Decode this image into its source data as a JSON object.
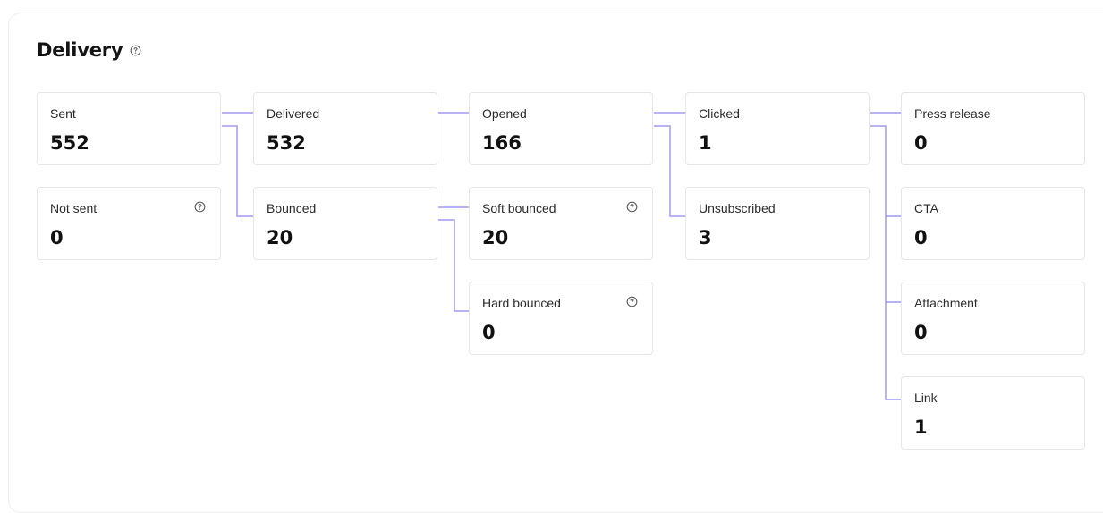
{
  "section": {
    "title": "Delivery"
  },
  "colors": {
    "connector": "#9f9af0",
    "card_border": "#e6e6e6",
    "help_icon": "#6b6b6b"
  },
  "stats": {
    "sent": {
      "label": "Sent",
      "value": "552"
    },
    "not_sent": {
      "label": "Not sent",
      "value": "0"
    },
    "delivered": {
      "label": "Delivered",
      "value": "532"
    },
    "bounced": {
      "label": "Bounced",
      "value": "20"
    },
    "opened": {
      "label": "Opened",
      "value": "166"
    },
    "soft_bounced": {
      "label": "Soft bounced",
      "value": "20"
    },
    "hard_bounced": {
      "label": "Hard bounced",
      "value": "0"
    },
    "clicked": {
      "label": "Clicked",
      "value": "1"
    },
    "unsubscribed": {
      "label": "Unsubscribed",
      "value": "3"
    },
    "press_release": {
      "label": "Press release",
      "value": "0"
    },
    "cta": {
      "label": "CTA",
      "value": "0"
    },
    "attachment": {
      "label": "Attachment",
      "value": "0"
    },
    "link": {
      "label": "Link",
      "value": "1"
    }
  }
}
